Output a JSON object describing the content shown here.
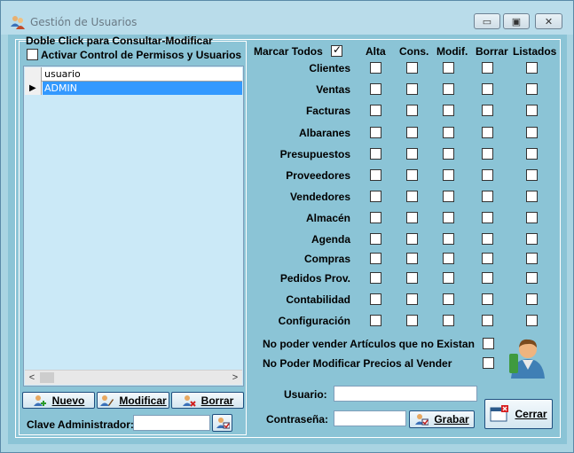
{
  "window": {
    "title": "Gestión de Usuarios",
    "controls": {
      "minimize": "▭",
      "maximize": "▣",
      "close": "✕"
    }
  },
  "left_panel": {
    "caption": "Doble Click para Consultar-Modificar",
    "activate_control_label": "Activar Control de Permisos y Usuarios",
    "activate_control_checked": false,
    "list": {
      "column_header": "usuario",
      "rows": [
        {
          "indicator": "▶",
          "user": "ADMIN",
          "selected": true
        }
      ],
      "scroll_left": "<",
      "scroll_right": ">"
    },
    "buttons": {
      "new": "Nuevo",
      "modify": "Modificar",
      "delete": "Borrar"
    },
    "admin_password_label": "Clave Administrador:",
    "admin_password_value": ""
  },
  "permissions": {
    "mark_all_label": "Marcar Todos",
    "mark_all_checked": true,
    "columns": [
      "Alta",
      "Cons.",
      "Modif.",
      "Borrar",
      "Listados"
    ],
    "rows": [
      {
        "label": "Clientes",
        "values": [
          false,
          false,
          false,
          false,
          false
        ]
      },
      {
        "label": "Ventas",
        "values": [
          false,
          false,
          false,
          false,
          false
        ]
      },
      {
        "label": "Facturas",
        "values": [
          false,
          false,
          false,
          false,
          false
        ]
      },
      {
        "label": "Albaranes",
        "values": [
          false,
          false,
          false,
          false,
          false
        ]
      },
      {
        "label": "Presupuestos",
        "values": [
          false,
          false,
          false,
          false,
          false
        ]
      },
      {
        "label": "Proveedores",
        "values": [
          false,
          false,
          false,
          false,
          false
        ]
      },
      {
        "label": "Vendedores",
        "values": [
          false,
          false,
          false,
          false,
          false
        ]
      },
      {
        "label": "Almacén",
        "values": [
          false,
          false,
          false,
          false,
          false
        ]
      },
      {
        "label": "Agenda",
        "values": [
          false,
          false,
          false,
          false,
          false
        ]
      },
      {
        "label": "Compras",
        "values": [
          false,
          false,
          false,
          false,
          false
        ]
      },
      {
        "label": "Pedidos Prov.",
        "values": [
          false,
          false,
          false,
          false,
          false
        ]
      },
      {
        "label": "Contabilidad",
        "values": [
          false,
          false,
          false,
          false,
          false
        ]
      },
      {
        "label": "Configuración",
        "values": [
          false,
          false,
          false,
          false,
          false
        ]
      }
    ],
    "no_stock_sale_label": "No poder vender Artículos que no Existan",
    "no_stock_sale_checked": false,
    "no_price_edit_label": "No Poder Modificar Precios al Vender",
    "no_price_edit_checked": false
  },
  "user_form": {
    "user_label": "Usuario:",
    "user_value": "",
    "password_label": "Contraseña:",
    "password_value": "",
    "save_button": "Grabar",
    "close_button": "Cerrar"
  },
  "icons": {
    "title": "users-icon",
    "new": "add-user-icon",
    "modify": "edit-user-icon",
    "delete": "delete-user-icon",
    "admin_key": "user-check-icon",
    "save": "user-check-icon",
    "close": "window-close-icon",
    "user_avatar": "user-avatar-icon"
  },
  "colors": {
    "window_bg": "#a9d4e2",
    "panel_bg": "#8bc4d6",
    "list_bg": "#cbe9f7",
    "selection": "#3399ff"
  }
}
